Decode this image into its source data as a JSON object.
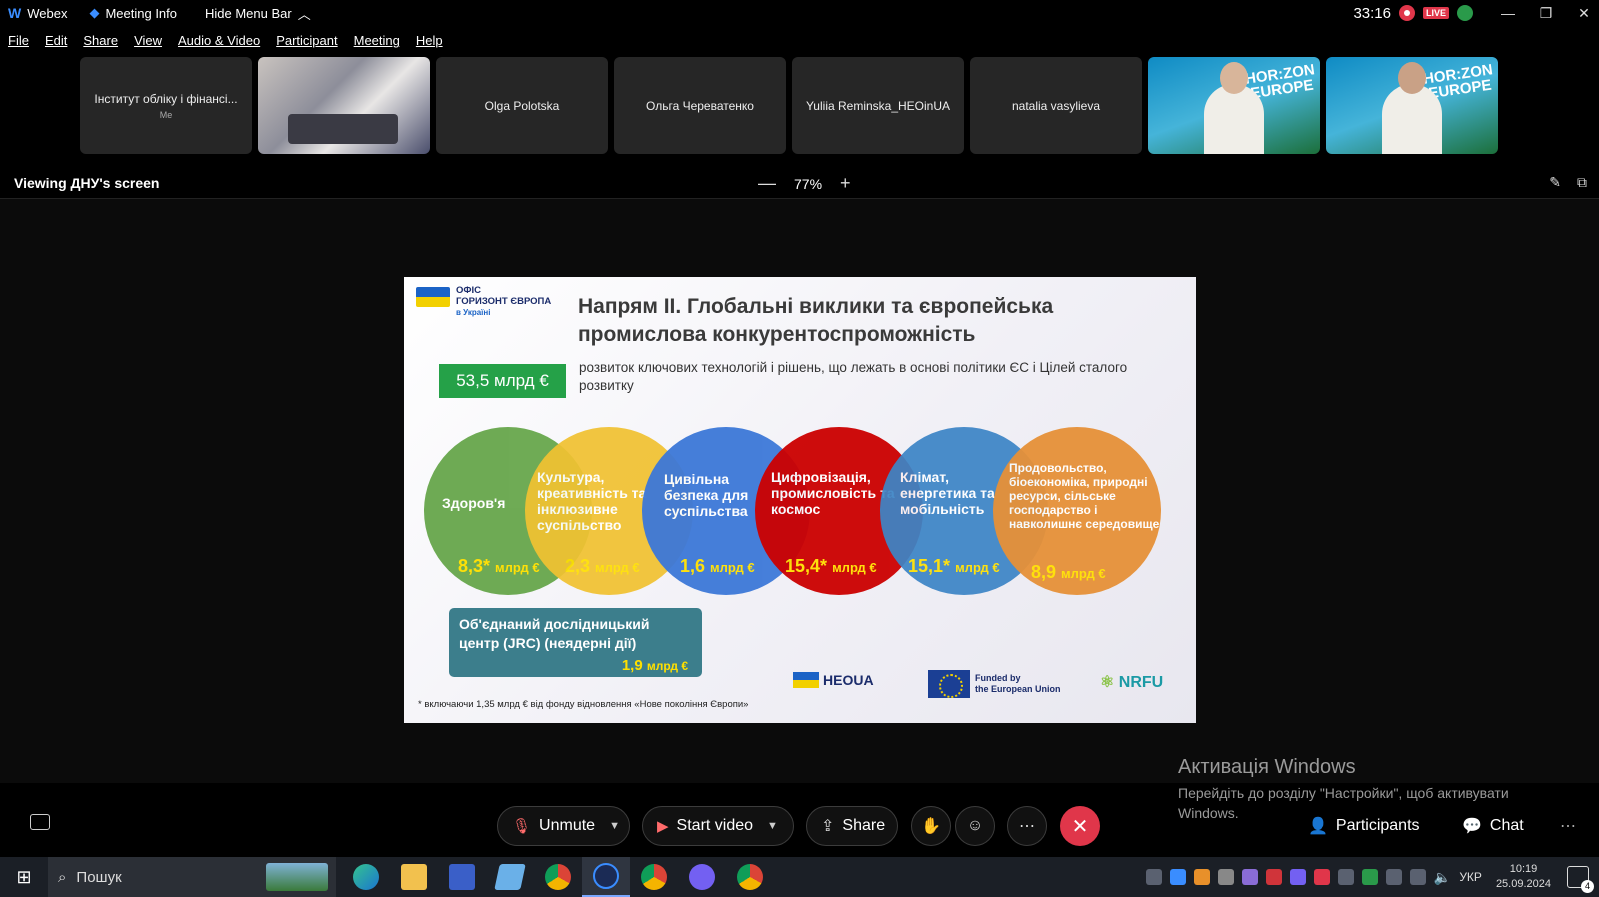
{
  "window": {
    "app_name": "Webex",
    "meeting_info": "Meeting Info",
    "hide_menu": "Hide Menu Bar",
    "timer": "33:16",
    "live_badge": "LIVE"
  },
  "menu": [
    "File",
    "Edit",
    "Share",
    "View",
    "Audio & Video",
    "Participant",
    "Meeting",
    "Help"
  ],
  "participants": [
    {
      "name": "Інститут обліку і фінансі...",
      "sub": "Me",
      "type": "name"
    },
    {
      "name": "",
      "sub": "",
      "type": "photo"
    },
    {
      "name": "Olga Polotska",
      "sub": "",
      "type": "name"
    },
    {
      "name": "Ольга Череватенко",
      "sub": "",
      "type": "name"
    },
    {
      "name": "Yuliia Reminska_HEOinUA",
      "sub": "",
      "type": "name"
    },
    {
      "name": "natalia vasylieva",
      "sub": "",
      "type": "name"
    },
    {
      "name": "",
      "sub": "",
      "type": "video"
    },
    {
      "name": "",
      "sub": "",
      "type": "video"
    }
  ],
  "viewing": {
    "label": "Viewing ДНУ's screen",
    "zoom": "77%",
    "zoom_out": "—",
    "zoom_in": "+"
  },
  "slide": {
    "office_line1": "ОФІС",
    "office_line2": "ГОРИЗОНТ ЄВРОПА",
    "office_line3": "в Україні",
    "title": "Напрям ІІ. Глобальні виклики та європейська промислова конкурентоспроможність",
    "budget": "53,5 млрд €",
    "budget_text": "розвиток ключових технологій і рішень, що лежать в основі політики ЄС і Цілей сталого розвитку",
    "clusters": [
      {
        "title": "Здоров'я",
        "amount": "8,3*",
        "unit": "млрд €"
      },
      {
        "title": "Культура, креативність та інклюзивне суспільство",
        "amount": "2,3",
        "unit": "млрд €"
      },
      {
        "title": "Цивільна безпека для суспільства",
        "amount": "1,6",
        "unit": "млрд €"
      },
      {
        "title": "Цифровізація, промисловість та космос",
        "amount": "15,4*",
        "unit": "млрд €"
      },
      {
        "title": "Клімат, енергетика та мобільність",
        "amount": "15,1*",
        "unit": "млрд €"
      },
      {
        "title": "Продовольство, біоекономіка, природні ресурси, сільське господарство і навколишнє середовище",
        "amount": "8,9",
        "unit": "млрд €"
      }
    ],
    "jrc_title": "Об'єднаний дослідницький центр (JRC) (неядерні дії)",
    "jrc_amount": "1,9",
    "jrc_unit": "млрд €",
    "footnote": "* включаючи 1,35 млрд € від фонду відновлення «Нове покоління Європи»",
    "logo_heo": "HEOUA",
    "logo_eu_line1": "Funded by",
    "logo_eu_line2": "the European Union",
    "logo_nrfu": "NRFU"
  },
  "watermark": {
    "heading": "Активація Windows",
    "text": "Перейдіть до розділу \"Настройки\", щоб активувати Windows."
  },
  "controls": {
    "unmute": "Unmute",
    "start_video": "Start video",
    "share": "Share",
    "participants": "Participants",
    "chat": "Chat"
  },
  "taskbar": {
    "search_placeholder": "Пошук",
    "language": "УКР",
    "time": "10:19",
    "date": "25.09.2024",
    "notifications": "4"
  },
  "colors": {
    "end_call": "#e0364a",
    "budget_green": "#25a148",
    "amount_yellow": "#ffe000"
  }
}
